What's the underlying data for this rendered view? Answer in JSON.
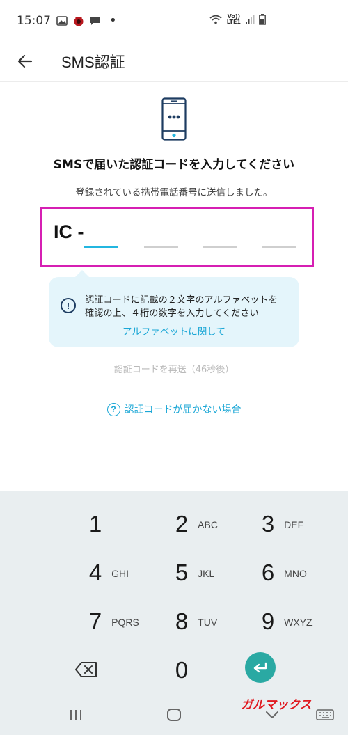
{
  "status_bar": {
    "time": "15:07",
    "network_label_top": "Vo))",
    "network_label_bottom": "LTE1"
  },
  "app_bar": {
    "title": "SMS認証",
    "back_icon": "arrow-left-icon"
  },
  "main": {
    "heading": "SMSで届いた認証コードを入力してください",
    "subtext": "登録されている携帯電話番号に送信しました。",
    "code_prefix": "IC -",
    "digit_count": 4,
    "info": {
      "line1": "認証コードに記載の２文字のアルファベットを",
      "line2": "確認の上、４桁の数字を入力してください",
      "link": "アルファベットに関して"
    },
    "resend": "認証コードを再送（46秒後）",
    "help_link": "認証コードが届かない場合"
  },
  "keypad": {
    "keys": [
      {
        "num": "1",
        "letters": ""
      },
      {
        "num": "2",
        "letters": "ABC"
      },
      {
        "num": "3",
        "letters": "DEF"
      },
      {
        "num": "4",
        "letters": "GHI"
      },
      {
        "num": "5",
        "letters": "JKL"
      },
      {
        "num": "6",
        "letters": "MNO"
      },
      {
        "num": "7",
        "letters": "PQRS"
      },
      {
        "num": "8",
        "letters": "TUV"
      },
      {
        "num": "9",
        "letters": "WXYZ"
      },
      {
        "num": "0",
        "letters": ""
      }
    ],
    "backspace_icon": "backspace-icon",
    "enter_icon": "enter-icon"
  },
  "nav_bar": {
    "watermark": "ガルマックス"
  },
  "colors": {
    "accent": "#23b6e0",
    "highlight_border": "#d61fb3",
    "enter_button": "#2aa9a3",
    "info_bg": "#e4f5fb",
    "watermark": "#e0191f"
  }
}
